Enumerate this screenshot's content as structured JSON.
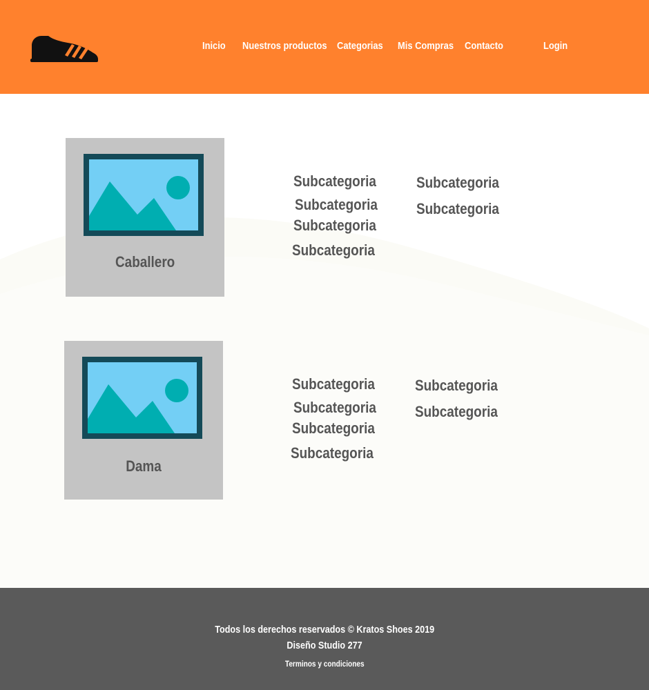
{
  "colors": {
    "header": "#ff812d",
    "card": "#c4c4c4",
    "text": "#555555",
    "footer": "#5a5a5a"
  },
  "header": {
    "logo_icon": "sneaker-icon",
    "nav": {
      "inicio": "Inicio",
      "productos": "Nuestros productos",
      "categorias": "Categorias",
      "compras": "Mis Compras",
      "contacto": "Contacto",
      "login": "Login"
    }
  },
  "categories": [
    {
      "title": "Caballero",
      "image_icon": "image-placeholder-icon",
      "subcategories": [
        "Subcategoria",
        "Subcategoria",
        "Subcategoria",
        "Subcategoria",
        "Subcategoria",
        "Subcategoria"
      ]
    },
    {
      "title": "Dama",
      "image_icon": "image-placeholder-icon",
      "subcategories": [
        "Subcategoria",
        "Subcategoria",
        "Subcategoria",
        "Subcategoria",
        "Subcategoria",
        "Subcategoria"
      ]
    }
  ],
  "footer": {
    "copyright": "Todos los derechos reservados © Kratos Shoes 2019",
    "design": "Diseño Studio 277",
    "terms": "Terminos y condiciones"
  }
}
